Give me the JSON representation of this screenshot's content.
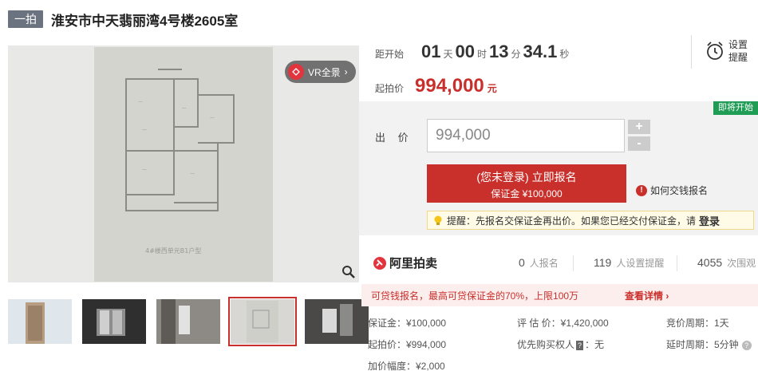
{
  "header": {
    "badge": "一拍",
    "title": "淮安市中天翡丽湾4号楼2605室"
  },
  "gallery": {
    "vr_label": "VR全景",
    "plan_caption": "4#楼西单元B1户型",
    "thumb_count": 5,
    "active_thumb": 4
  },
  "countdown": {
    "label": "距开始",
    "days": "01",
    "days_unit": "天",
    "hours": "00",
    "hours_unit": "时",
    "minutes": "13",
    "minutes_unit": "分",
    "seconds": "34.1",
    "seconds_unit": "秒"
  },
  "reminder": {
    "label": "设置提醒"
  },
  "start_price": {
    "label": "起拍价",
    "value": "994,000",
    "unit": "元"
  },
  "bid": {
    "soon_badge": "即将开始",
    "label": "出 价",
    "input_value": "994,000",
    "plus": "+",
    "minus": "-",
    "signup_line1": "(您未登录) 立即报名",
    "signup_line2": "保证金 ¥100,000",
    "howto_label": "如何交钱报名",
    "tip_text": "提醒：先报名交保证金再出价。如果您已经交付保证金，请",
    "tip_login": "登录"
  },
  "stats": {
    "brand": "阿里拍卖",
    "signups": "0",
    "signups_label": "人报名",
    "reminders": "119",
    "reminders_label": "人设置提醒",
    "views": "4055",
    "views_label": "次围观"
  },
  "loan": {
    "text": "可贷钱报名，最高可贷保证金的70%，上限100万",
    "link": "查看详情"
  },
  "details": {
    "deposit": "保证金：¥100,000",
    "start": "起拍价：¥994,000",
    "increment": "加价幅度：¥2,000",
    "appraisal": "评 估 价：¥1,420,000",
    "priority_label": "优先购买权人",
    "priority_badge": "?",
    "priority_value": "：无",
    "cycle": "竞价周期：1天",
    "delay": "延时周期：5分钟"
  },
  "colors": {
    "accent": "#c9302c",
    "green": "#1f9d55",
    "badge_gray": "#6b7280"
  }
}
